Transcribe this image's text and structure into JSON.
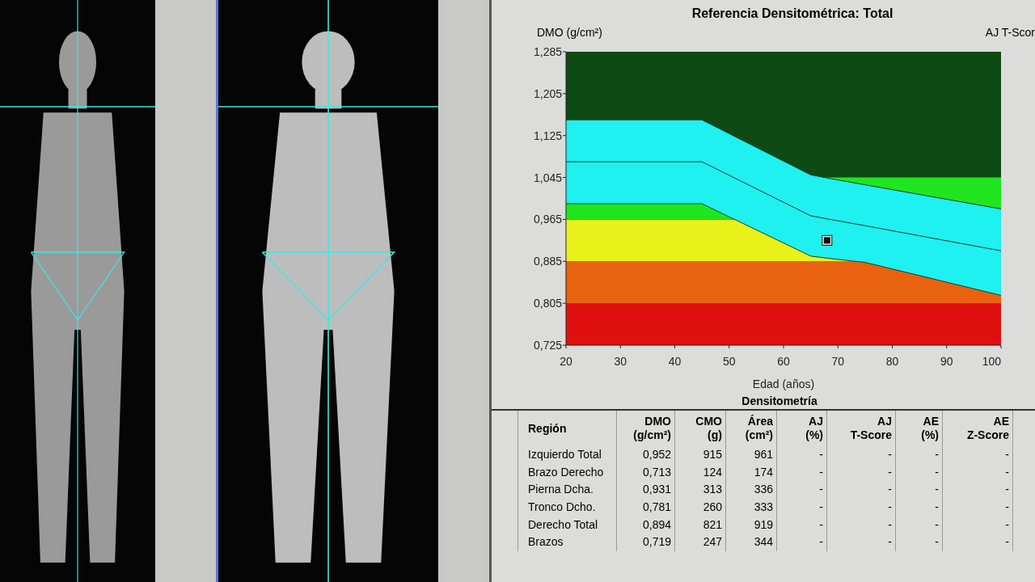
{
  "scans": [
    {
      "kind": "skeleton"
    },
    {
      "kind": "soft-tissue"
    }
  ],
  "chart": {
    "right_axis_label": "AJ T-Scor",
    "chart_data": {
      "type": "line",
      "title": "Referencia Densitométrica: Total",
      "xlabel": "Edad (años)",
      "ylabel": "DMO (g/cm²)",
      "x": [
        20,
        45,
        65,
        68,
        75,
        100
      ],
      "series": [
        {
          "color": "#1a3a2a",
          "values": [
            1.155,
            1.155,
            1.05,
            1.044,
            1.031,
            0.985
          ]
        },
        {
          "color": "#1a3a2a",
          "values": [
            1.075,
            1.075,
            0.972,
            0.966,
            0.953,
            0.905
          ]
        },
        {
          "color": "#1a3a2a",
          "values": [
            0.995,
            0.995,
            0.895,
            0.891,
            0.883,
            0.82
          ]
        },
        {
          "color": "#111111",
          "marker": "square",
          "values": [
            null,
            null,
            null,
            0.925,
            null,
            null
          ]
        }
      ],
      "bands": [
        {
          "axis": "y",
          "from": 0.725,
          "to": 0.805,
          "color": "#e01010"
        },
        {
          "axis": "y",
          "from": 0.805,
          "to": 0.885,
          "color": "#e8620f"
        },
        {
          "axis": "y",
          "from": 0.885,
          "to": 0.965,
          "color": "#e8f21a"
        },
        {
          "axis": "y",
          "from": 0.965,
          "to": 1.045,
          "color": "#1fe61f"
        }
      ],
      "xlim": [
        20,
        100
      ],
      "ylim": [
        0.725,
        1.285
      ],
      "xticks": [
        20,
        30,
        40,
        50,
        60,
        70,
        80,
        90,
        100
      ],
      "yticks": [
        {
          "value": 0.725,
          "label": "0,725"
        },
        {
          "value": 0.805,
          "label": "0,805"
        },
        {
          "value": 0.885,
          "label": "0,885"
        },
        {
          "value": 0.965,
          "label": "0,965"
        },
        {
          "value": 1.045,
          "label": "1,045"
        },
        {
          "value": 1.125,
          "label": "1,125"
        },
        {
          "value": 1.205,
          "label": "1,205"
        },
        {
          "value": 1.285,
          "label": "1,285"
        }
      ]
    }
  },
  "table": {
    "title": "Densitometría",
    "columns": [
      "Región",
      "DMO (g/cm²)",
      "CMO (g)",
      "Área (cm²)",
      "AJ (%)",
      "AJ T-Score",
      "AE (%)",
      "AE Z-Score"
    ],
    "rows": [
      [
        "Izquierdo Total",
        "0,952",
        "915",
        "961",
        "-",
        "-",
        "-",
        "-"
      ],
      [
        "Brazo Derecho",
        "0,713",
        "124",
        "174",
        "-",
        "-",
        "-",
        "-"
      ],
      [
        "Pierna Dcha.",
        "0,931",
        "313",
        "336",
        "-",
        "-",
        "-",
        "-"
      ],
      [
        "Tronco Dcho.",
        "0,781",
        "260",
        "333",
        "-",
        "-",
        "-",
        "-"
      ],
      [
        "Derecho Total",
        "0,894",
        "821",
        "919",
        "-",
        "-",
        "-",
        "-"
      ],
      [
        "Brazos",
        "0,719",
        "247",
        "344",
        "-",
        "-",
        "-",
        "-"
      ]
    ]
  }
}
